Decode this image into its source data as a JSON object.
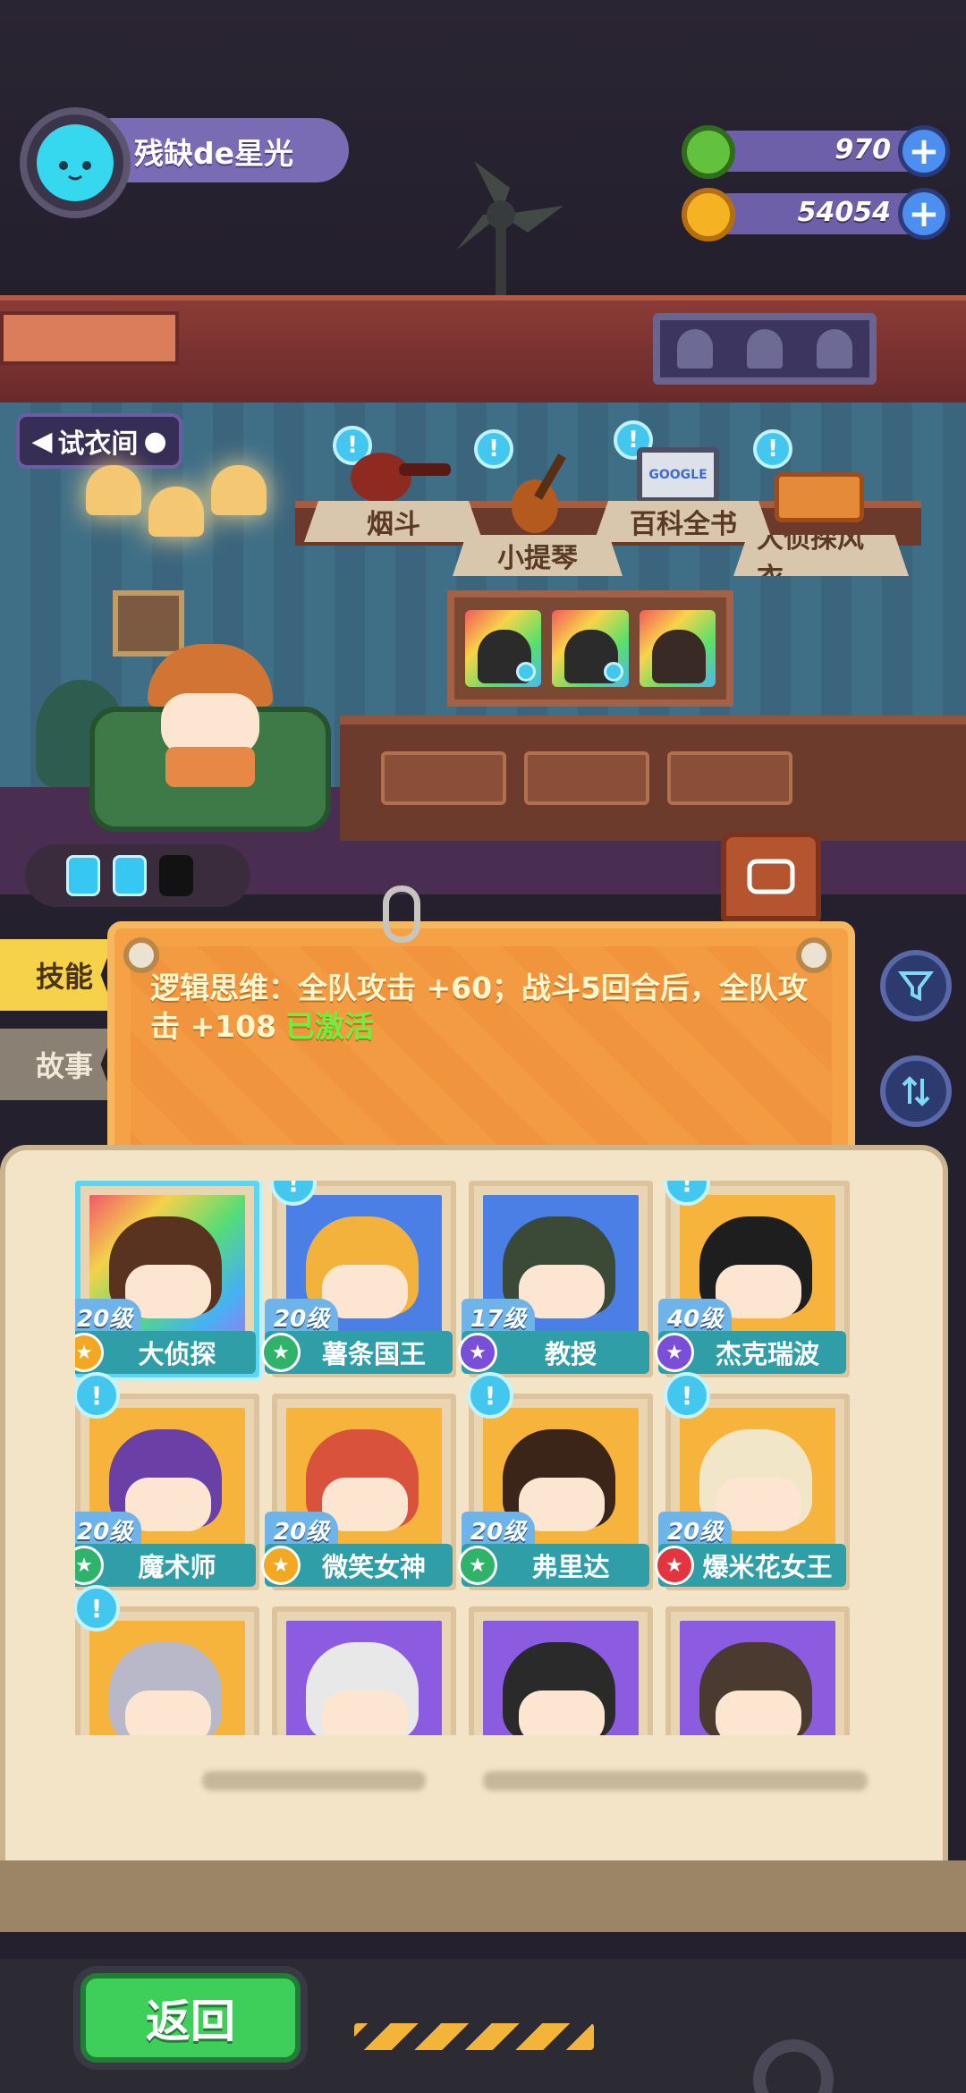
{
  "player": {
    "name": "残缺de星光"
  },
  "resources": [
    {
      "icon": "green-donut-icon",
      "value": "970",
      "color": "#62c23d"
    },
    {
      "icon": "gold-planet-coin-icon",
      "value": "54054",
      "color": "#f5b323"
    }
  ],
  "room": {
    "dressing_room_label": "试衣间",
    "items": [
      {
        "label": "烟斗",
        "icon": "pipe-icon"
      },
      {
        "label": "小提琴",
        "icon": "violin-icon"
      },
      {
        "label": "百科全书",
        "icon": "encyclopedia-icon",
        "screen_text": "GOOGLE"
      },
      {
        "label": "大侦探风衣",
        "icon": "trench-coat-icon"
      }
    ],
    "skill_slots": [
      "active",
      "active",
      "empty"
    ]
  },
  "tabs": {
    "skill": "技能",
    "story": "故事"
  },
  "skill": {
    "text": "逻辑思维：全队攻击 +60；战斗5回合后，全队攻击 +108",
    "status": "已激活"
  },
  "characters": [
    {
      "level": "20级",
      "name": "大侦探",
      "rank": "gold",
      "art": "rainbow",
      "hair": "#5a3320",
      "alert": false,
      "selected": true
    },
    {
      "level": "20级",
      "name": "薯条国王",
      "rank": "green",
      "art": "blue",
      "hair": "#f3b23b",
      "alert": true,
      "selected": false
    },
    {
      "level": "17级",
      "name": "教授",
      "rank": "purple",
      "art": "blue",
      "hair": "#3a4a36",
      "alert": false,
      "selected": false
    },
    {
      "level": "40级",
      "name": "杰克瑞波",
      "rank": "purple",
      "art": "orange",
      "hair": "#1e1e1e",
      "alert": true,
      "selected": false
    },
    {
      "level": "20级",
      "name": "魔术师",
      "rank": "green",
      "art": "orange",
      "hair": "#6a3fa6",
      "alert": true,
      "selected": false
    },
    {
      "level": "20级",
      "name": "微笑女神",
      "rank": "gold",
      "art": "orange",
      "hair": "#d9523c",
      "alert": false,
      "selected": false
    },
    {
      "level": "20级",
      "name": "弗里达",
      "rank": "green",
      "art": "orange",
      "hair": "#3b2418",
      "alert": true,
      "selected": false
    },
    {
      "level": "20级",
      "name": "爆米花女王",
      "rank": "red",
      "art": "orange",
      "hair": "#f1e6c8",
      "alert": true,
      "selected": false
    },
    {
      "level": "",
      "name": "",
      "rank": "",
      "art": "orange",
      "hair": "#b8b8c8",
      "alert": true,
      "selected": false
    },
    {
      "level": "",
      "name": "",
      "rank": "",
      "art": "purple",
      "hair": "#e8e8e8",
      "alert": false,
      "selected": false
    },
    {
      "level": "",
      "name": "",
      "rank": "",
      "art": "purple",
      "hair": "#2a2a2a",
      "alert": false,
      "selected": false
    },
    {
      "level": "",
      "name": "",
      "rank": "",
      "art": "purple",
      "hair": "#4a3a30",
      "alert": false,
      "selected": false
    }
  ],
  "bottom": {
    "back": "返回"
  }
}
